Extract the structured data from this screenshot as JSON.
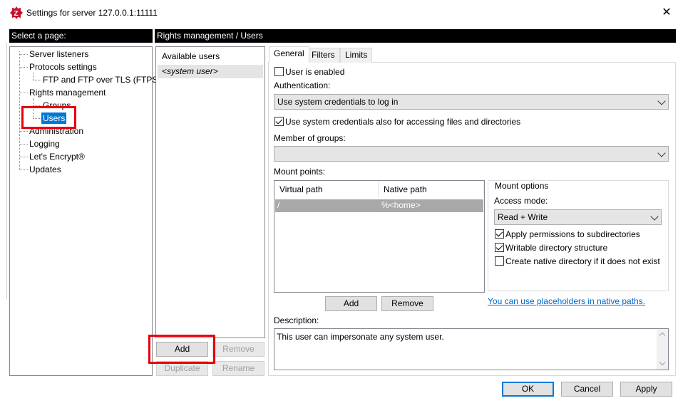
{
  "window": {
    "title": "Settings for server 127.0.0.1:11111",
    "close_glyph": "✕"
  },
  "headers": {
    "left": "Select a page:",
    "right": "Rights management / Users"
  },
  "tree": {
    "items": [
      {
        "label": "Server listeners"
      },
      {
        "label": "Protocols settings"
      },
      {
        "label": "FTP and FTP over TLS (FTPS)"
      },
      {
        "label": "Rights management"
      },
      {
        "label": "Groups"
      },
      {
        "label": "Users"
      },
      {
        "label": "Administration"
      },
      {
        "label": "Logging"
      },
      {
        "label": "Let's Encrypt®"
      },
      {
        "label": "Updates"
      }
    ]
  },
  "users": {
    "header": "Available users",
    "items": [
      "<system user>"
    ],
    "buttons": {
      "add": "Add",
      "remove": "Remove",
      "duplicate": "Duplicate",
      "rename": "Rename"
    }
  },
  "tabs": [
    {
      "label": "General",
      "active": true
    },
    {
      "label": "Filters",
      "active": false
    },
    {
      "label": "Limits",
      "active": false
    }
  ],
  "general": {
    "user_enabled": {
      "label": "User is enabled",
      "checked": false
    },
    "auth_label": "Authentication:",
    "auth_value": "Use system credentials to log in",
    "sys_creds": {
      "label": "Use system credentials also for accessing files and directories",
      "checked": true
    },
    "groups_label": "Member of groups:",
    "groups_value": "",
    "mount_label": "Mount points:",
    "mount_table": {
      "columns": [
        "Virtual path",
        "Native path"
      ],
      "rows": [
        {
          "virtual": "/",
          "native": "%<home>"
        }
      ]
    },
    "mount_buttons": {
      "add": "Add",
      "remove": "Remove"
    },
    "mount_options": {
      "title": "Mount options",
      "access_label": "Access mode:",
      "access_value": "Read + Write",
      "apply_perms": {
        "label": "Apply permissions to subdirectories",
        "checked": true
      },
      "writable": {
        "label": "Writable directory structure",
        "checked": true
      },
      "create_native": {
        "label": "Create native directory if it does not exist",
        "checked": false
      }
    },
    "placeholder_link": "You can use placeholders in native paths.",
    "desc_label": "Description:",
    "desc_value": "This user can impersonate any system user."
  },
  "dialog_buttons": {
    "ok": "OK",
    "cancel": "Cancel",
    "apply": "Apply"
  },
  "colors": {
    "accent": "#0078d7",
    "highlight": "#e8000b",
    "brand_icon": "#c8102e"
  }
}
